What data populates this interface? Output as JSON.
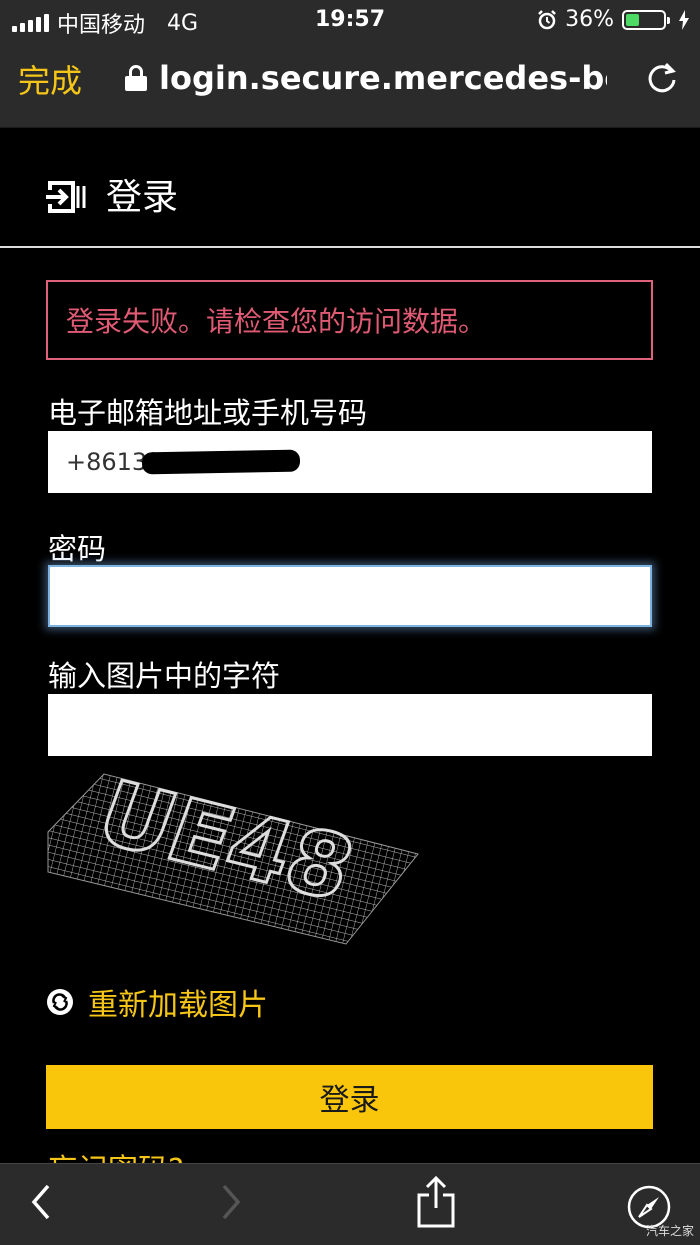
{
  "status_bar": {
    "carrier": "中国移动",
    "network": "4G",
    "time": "19:57",
    "battery_percent": "36%",
    "battery_level": 0.36,
    "battery_color": "#4cd964"
  },
  "browser": {
    "done_label": "完成",
    "url": "login.secure.mercedes-benz.com",
    "lock_icon": "lock-icon",
    "reload_icon": "reload-icon"
  },
  "page": {
    "title": "登录",
    "error_message": "登录失败。请检查您的访问数据。",
    "email_label": "电子邮箱地址或手机号码",
    "email_value": "+8613****",
    "password_label": "密码",
    "password_value": "",
    "captcha_label": "输入图片中的字符",
    "captcha_value": "",
    "captcha_text": "UE48",
    "reload_image_label": "重新加载图片",
    "login_button": "登录",
    "forgot_password": "忘记密码?"
  },
  "toolbar": {
    "back_icon": "chevron-left-icon",
    "forward_icon": "chevron-right-icon",
    "share_icon": "share-icon",
    "safari_icon": "compass-icon"
  },
  "watermark": "汽车之家",
  "colors": {
    "accent": "#f9c60c",
    "error": "#e05a74",
    "bar_bg": "#2b2b2b"
  }
}
